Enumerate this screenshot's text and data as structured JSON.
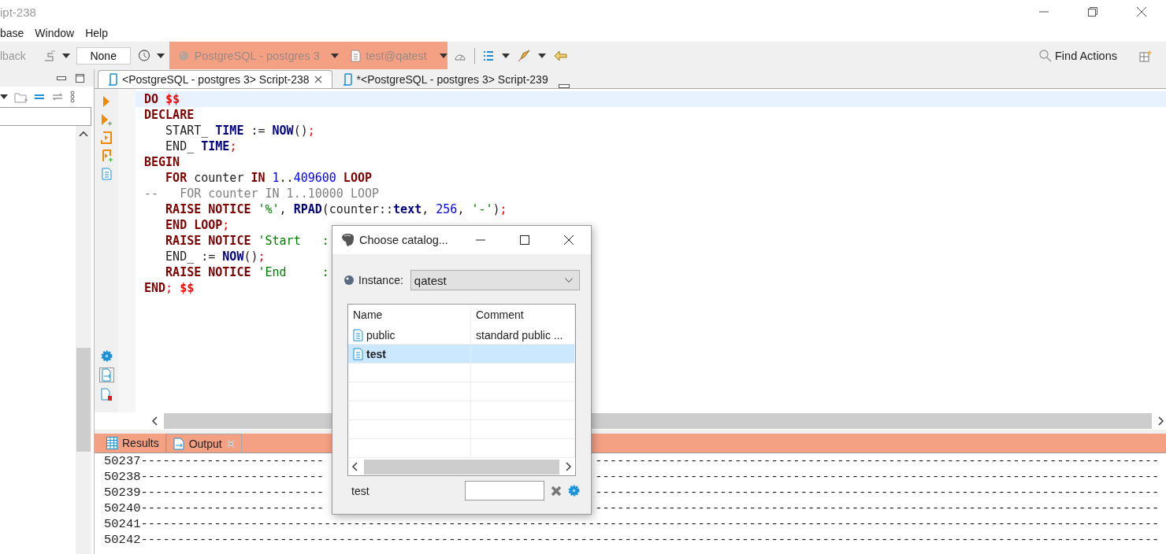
{
  "window": {
    "title": "ipt-238"
  },
  "menu": [
    "base",
    "Window",
    "Help"
  ],
  "toolbar": {
    "rollback": {
      "label": "lback",
      "disabled": true
    },
    "transaction_mode": "None",
    "connection": "PostgreSQL - postgres 3",
    "schema": "test@qatest",
    "find_actions": "Find Actions"
  },
  "editor_tabs": [
    {
      "label": "<PostgreSQL - postgres 3> Script-238",
      "selected": true,
      "closable": true
    },
    {
      "label": "*<PostgreSQL - postgres 3> Script-239",
      "selected": false,
      "closable": false
    }
  ],
  "code_lines": [
    [
      {
        "kind": "kw",
        "text": "DO "
      },
      {
        "kind": "dollar",
        "text": "$$"
      }
    ],
    [
      {
        "kind": "kw",
        "text": "DECLARE"
      }
    ],
    [
      {
        "kind": "plain",
        "text": "   START_ "
      },
      {
        "kind": "func",
        "text": "TIME"
      },
      {
        "kind": "plain",
        "text": " := "
      },
      {
        "kind": "func",
        "text": "NOW"
      },
      {
        "kind": "plain",
        "text": "()"
      },
      {
        "kind": "punct",
        "text": ";"
      }
    ],
    [
      {
        "kind": "plain",
        "text": "   END_ "
      },
      {
        "kind": "func",
        "text": "TIME"
      },
      {
        "kind": "punct",
        "text": ";"
      }
    ],
    [
      {
        "kind": "kw",
        "text": "BEGIN"
      }
    ],
    [
      {
        "kind": "kw",
        "text": "   FOR"
      },
      {
        "kind": "plain",
        "text": " counter "
      },
      {
        "kind": "kw",
        "text": "IN "
      },
      {
        "kind": "num",
        "text": "1"
      },
      {
        "kind": "plain",
        "text": ".."
      },
      {
        "kind": "num",
        "text": "409600"
      },
      {
        "kind": "kw",
        "text": " LOOP"
      }
    ],
    [
      {
        "kind": "comment",
        "text": "--   FOR counter IN 1..10000 LOOP"
      }
    ],
    [
      {
        "kind": "kw",
        "text": "   RAISE NOTICE "
      },
      {
        "kind": "str",
        "text": "'%'"
      },
      {
        "kind": "plain",
        "text": ", "
      },
      {
        "kind": "func",
        "text": "RPAD"
      },
      {
        "kind": "plain",
        "text": "(counter::"
      },
      {
        "kind": "func",
        "text": "text"
      },
      {
        "kind": "plain",
        "text": ", "
      },
      {
        "kind": "num",
        "text": "256"
      },
      {
        "kind": "plain",
        "text": ", "
      },
      {
        "kind": "str",
        "text": "'-'"
      },
      {
        "kind": "plain",
        "text": ")"
      },
      {
        "kind": "punct",
        "text": ";"
      }
    ],
    [
      {
        "kind": "kw",
        "text": "   END LOOP"
      },
      {
        "kind": "punct",
        "text": ";"
      }
    ],
    [
      {
        "kind": "kw",
        "text": "   RAISE NOTICE "
      },
      {
        "kind": "str",
        "text": "'Start   :"
      }
    ],
    [
      {
        "kind": "plain",
        "text": "   END_ := "
      },
      {
        "kind": "func",
        "text": "NOW"
      },
      {
        "kind": "plain",
        "text": "()"
      },
      {
        "kind": "punct",
        "text": ";"
      }
    ],
    [
      {
        "kind": "kw",
        "text": "   RAISE NOTICE "
      },
      {
        "kind": "str",
        "text": "'End     :"
      }
    ],
    [
      {
        "kind": "kw",
        "text": "END"
      },
      {
        "kind": "punct",
        "text": "; "
      },
      {
        "kind": "dollar",
        "text": "$$"
      }
    ]
  ],
  "output_tabs": [
    {
      "label": "Results",
      "selected": false,
      "closable": false
    },
    {
      "label": "Output",
      "selected": true,
      "closable": true
    }
  ],
  "output_lines": [
    {
      "segments": [
        "50237-------------------------",
        "-----------------------------------------------------------------------------"
      ]
    },
    {
      "segments": [
        "50238-------------------------",
        "-----------------------------------------------------------------------------"
      ]
    },
    {
      "segments": [
        "50239-------------------------",
        "-----------------------------------------------------------------------------"
      ]
    },
    {
      "segments": [
        "50240-------------------------",
        "-----------------------------------------------------------------------------"
      ]
    },
    {
      "segments": [
        "50241-------------------------------------------------------------------------------------------------------------------------------------------"
      ]
    },
    {
      "segments": [
        "50242-------------------------------------------------------------------------------------------------------------------------------------------"
      ]
    }
  ],
  "dialog": {
    "title": "Choose catalog...",
    "instance_label": "Instance:",
    "instance": "qatest",
    "columns": [
      "Name",
      "Comment"
    ],
    "rows": [
      {
        "name": "public",
        "comment": "standard public ...",
        "selected": false
      },
      {
        "name": "test",
        "selected": true
      }
    ],
    "status": "test"
  }
}
